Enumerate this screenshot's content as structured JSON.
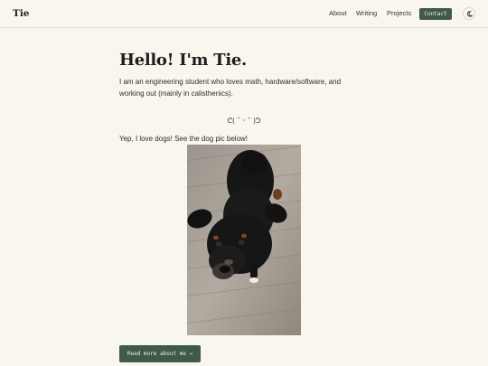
{
  "header": {
    "logo": "Tie",
    "nav": [
      {
        "label": "About"
      },
      {
        "label": "Writing"
      },
      {
        "label": "Projects"
      }
    ],
    "contact_label": "Contact",
    "theme_icon": "moon-icon"
  },
  "hero": {
    "title": "Hello! I'm Tie.",
    "intro": "I am an engineering student who loves math, hardware/software, and working out (mainly in calisthenics).",
    "kaomoji": "ᕦ( ˘ ᵕ ˘ )ᕤ"
  },
  "dog": {
    "text": "Yep, I love dogs! See the dog pic below!"
  },
  "cta": {
    "label": "Read more about me →"
  },
  "colors": {
    "background": "#f9f6ee",
    "accent": "#3f5a45"
  }
}
